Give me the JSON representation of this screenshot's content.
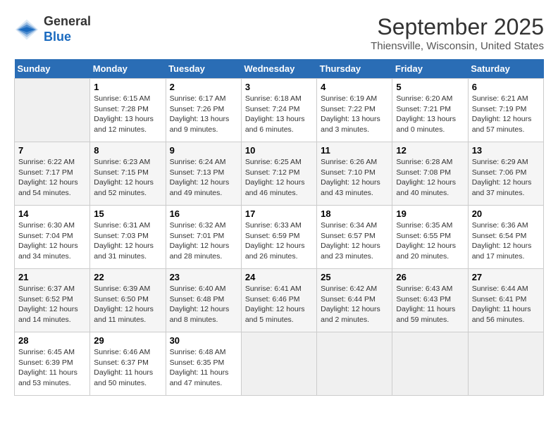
{
  "logo": {
    "general": "General",
    "blue": "Blue"
  },
  "header": {
    "month": "September 2025",
    "location": "Thiensville, Wisconsin, United States"
  },
  "weekdays": [
    "Sunday",
    "Monday",
    "Tuesday",
    "Wednesday",
    "Thursday",
    "Friday",
    "Saturday"
  ],
  "weeks": [
    [
      null,
      {
        "day": "1",
        "sunrise": "6:15 AM",
        "sunset": "7:28 PM",
        "daylight": "13 hours and 12 minutes."
      },
      {
        "day": "2",
        "sunrise": "6:17 AM",
        "sunset": "7:26 PM",
        "daylight": "13 hours and 9 minutes."
      },
      {
        "day": "3",
        "sunrise": "6:18 AM",
        "sunset": "7:24 PM",
        "daylight": "13 hours and 6 minutes."
      },
      {
        "day": "4",
        "sunrise": "6:19 AM",
        "sunset": "7:22 PM",
        "daylight": "13 hours and 3 minutes."
      },
      {
        "day": "5",
        "sunrise": "6:20 AM",
        "sunset": "7:21 PM",
        "daylight": "13 hours and 0 minutes."
      },
      {
        "day": "6",
        "sunrise": "6:21 AM",
        "sunset": "7:19 PM",
        "daylight": "12 hours and 57 minutes."
      }
    ],
    [
      {
        "day": "7",
        "sunrise": "6:22 AM",
        "sunset": "7:17 PM",
        "daylight": "12 hours and 54 minutes."
      },
      {
        "day": "8",
        "sunrise": "6:23 AM",
        "sunset": "7:15 PM",
        "daylight": "12 hours and 52 minutes."
      },
      {
        "day": "9",
        "sunrise": "6:24 AM",
        "sunset": "7:13 PM",
        "daylight": "12 hours and 49 minutes."
      },
      {
        "day": "10",
        "sunrise": "6:25 AM",
        "sunset": "7:12 PM",
        "daylight": "12 hours and 46 minutes."
      },
      {
        "day": "11",
        "sunrise": "6:26 AM",
        "sunset": "7:10 PM",
        "daylight": "12 hours and 43 minutes."
      },
      {
        "day": "12",
        "sunrise": "6:28 AM",
        "sunset": "7:08 PM",
        "daylight": "12 hours and 40 minutes."
      },
      {
        "day": "13",
        "sunrise": "6:29 AM",
        "sunset": "7:06 PM",
        "daylight": "12 hours and 37 minutes."
      }
    ],
    [
      {
        "day": "14",
        "sunrise": "6:30 AM",
        "sunset": "7:04 PM",
        "daylight": "12 hours and 34 minutes."
      },
      {
        "day": "15",
        "sunrise": "6:31 AM",
        "sunset": "7:03 PM",
        "daylight": "12 hours and 31 minutes."
      },
      {
        "day": "16",
        "sunrise": "6:32 AM",
        "sunset": "7:01 PM",
        "daylight": "12 hours and 28 minutes."
      },
      {
        "day": "17",
        "sunrise": "6:33 AM",
        "sunset": "6:59 PM",
        "daylight": "12 hours and 26 minutes."
      },
      {
        "day": "18",
        "sunrise": "6:34 AM",
        "sunset": "6:57 PM",
        "daylight": "12 hours and 23 minutes."
      },
      {
        "day": "19",
        "sunrise": "6:35 AM",
        "sunset": "6:55 PM",
        "daylight": "12 hours and 20 minutes."
      },
      {
        "day": "20",
        "sunrise": "6:36 AM",
        "sunset": "6:54 PM",
        "daylight": "12 hours and 17 minutes."
      }
    ],
    [
      {
        "day": "21",
        "sunrise": "6:37 AM",
        "sunset": "6:52 PM",
        "daylight": "12 hours and 14 minutes."
      },
      {
        "day": "22",
        "sunrise": "6:39 AM",
        "sunset": "6:50 PM",
        "daylight": "12 hours and 11 minutes."
      },
      {
        "day": "23",
        "sunrise": "6:40 AM",
        "sunset": "6:48 PM",
        "daylight": "12 hours and 8 minutes."
      },
      {
        "day": "24",
        "sunrise": "6:41 AM",
        "sunset": "6:46 PM",
        "daylight": "12 hours and 5 minutes."
      },
      {
        "day": "25",
        "sunrise": "6:42 AM",
        "sunset": "6:44 PM",
        "daylight": "12 hours and 2 minutes."
      },
      {
        "day": "26",
        "sunrise": "6:43 AM",
        "sunset": "6:43 PM",
        "daylight": "11 hours and 59 minutes."
      },
      {
        "day": "27",
        "sunrise": "6:44 AM",
        "sunset": "6:41 PM",
        "daylight": "11 hours and 56 minutes."
      }
    ],
    [
      {
        "day": "28",
        "sunrise": "6:45 AM",
        "sunset": "6:39 PM",
        "daylight": "11 hours and 53 minutes."
      },
      {
        "day": "29",
        "sunrise": "6:46 AM",
        "sunset": "6:37 PM",
        "daylight": "11 hours and 50 minutes."
      },
      {
        "day": "30",
        "sunrise": "6:48 AM",
        "sunset": "6:35 PM",
        "daylight": "11 hours and 47 minutes."
      },
      null,
      null,
      null,
      null
    ]
  ],
  "labels": {
    "sunrise": "Sunrise:",
    "sunset": "Sunset:",
    "daylight": "Daylight:"
  }
}
